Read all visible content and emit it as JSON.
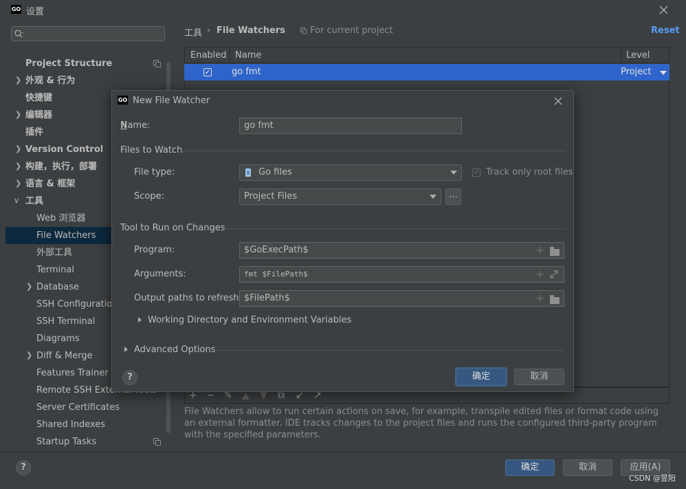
{
  "window": {
    "title": "设置",
    "logo_text": "GO"
  },
  "sidebar": {
    "search_placeholder": "",
    "items": [
      {
        "label": "Project Structure",
        "bold": true
      },
      {
        "label": "外观 & 行为",
        "bold": true
      },
      {
        "label": "快捷键",
        "bold": true
      },
      {
        "label": "编辑器",
        "bold": true
      },
      {
        "label": "插件",
        "bold": true
      },
      {
        "label": "Version Control",
        "bold": true
      },
      {
        "label": "构建，执行，部署",
        "bold": true
      },
      {
        "label": "语言 & 框架",
        "bold": true
      },
      {
        "label": "工具",
        "bold": true
      },
      {
        "label": "Web 浏览器"
      },
      {
        "label": "File Watchers",
        "selected": true
      },
      {
        "label": "外部工具"
      },
      {
        "label": "Terminal"
      },
      {
        "label": "Database"
      },
      {
        "label": "SSH Configurations"
      },
      {
        "label": "SSH Terminal"
      },
      {
        "label": "Diagrams"
      },
      {
        "label": "Diff & Merge"
      },
      {
        "label": "Features Trainer"
      },
      {
        "label": "Remote SSH External Tools"
      },
      {
        "label": "Server Certificates"
      },
      {
        "label": "Shared Indexes"
      },
      {
        "label": "Startup Tasks"
      }
    ]
  },
  "breadcrumb": {
    "parent": "工具",
    "sep": "›",
    "current": "File Watchers",
    "scope": "For current project",
    "reset": "Reset"
  },
  "table": {
    "headers": {
      "enabled": "Enabled",
      "name": "Name",
      "level": "Level"
    },
    "rows": [
      {
        "enabled": true,
        "name": "go fmt",
        "level": "Project"
      }
    ]
  },
  "description": "File Watchers allow to run certain actions on save, for example, transpile edited files or format code using an external formatter. IDE tracks changes to the project files and runs the configured third-party program with the specified parameters.",
  "footer": {
    "ok": "确定",
    "cancel": "取消",
    "apply": "应用(A)",
    "help": "?",
    "watermark": "CSDN @昱阳"
  },
  "dialog": {
    "title": "New File Watcher",
    "logo_text": "GO",
    "name_label": "Name:",
    "name_value": "go fmt",
    "files_to_watch": "Files to Watch",
    "file_type_label": "File type:",
    "file_type_value": "Go files",
    "track_root_label": "Track only root files",
    "scope_label": "Scope:",
    "scope_value": "Project Files",
    "scope_more": "...",
    "tool_section": "Tool to Run on Changes",
    "program_label": "Program:",
    "program_value": "$GoExecPath$",
    "arguments_label": "Arguments:",
    "arguments_value": "fmt $FilePath$",
    "output_label": "Output paths to refresh:",
    "output_value": "$FilePath$",
    "working_dir": "Working Directory and Environment Variables",
    "advanced": "Advanced Options",
    "ok": "确定",
    "cancel": "取消",
    "help": "?"
  }
}
